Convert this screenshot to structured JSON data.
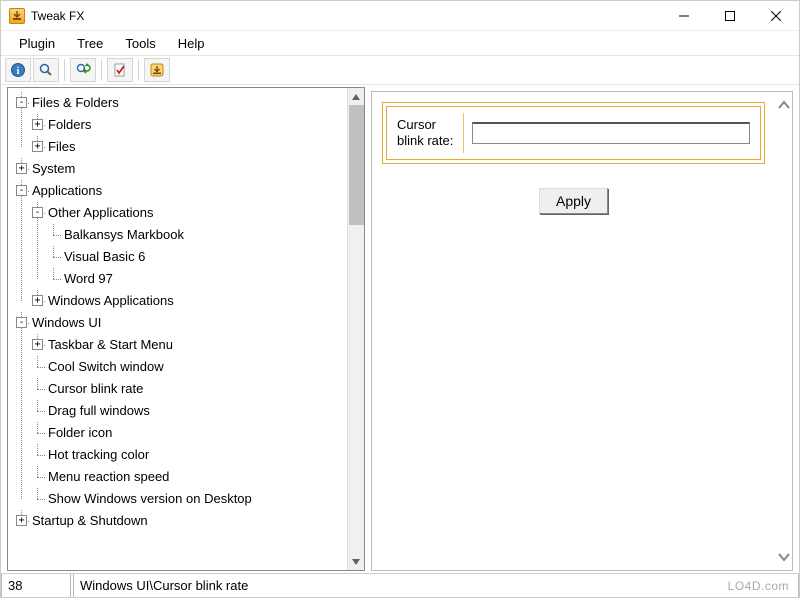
{
  "window": {
    "title": "Tweak FX"
  },
  "menu": {
    "items": [
      "Plugin",
      "Tree",
      "Tools",
      "Help"
    ]
  },
  "toolbar": {
    "buttons": [
      "info",
      "search",
      "refresh-search",
      "validate",
      "import"
    ]
  },
  "tree": {
    "nodes": [
      {
        "label": "Files & Folders",
        "expander": "-",
        "level": 0,
        "children": [
          {
            "label": "Folders",
            "expander": "+",
            "level": 1
          },
          {
            "label": "Files",
            "expander": "+",
            "level": 1
          }
        ]
      },
      {
        "label": "System",
        "expander": "+",
        "level": 0
      },
      {
        "label": "Applications",
        "expander": "-",
        "level": 0,
        "children": [
          {
            "label": "Other Applications",
            "expander": "-",
            "level": 1,
            "children": [
              {
                "label": "Balkansys Markbook",
                "level": 2
              },
              {
                "label": "Visual Basic 6",
                "level": 2
              },
              {
                "label": "Word 97",
                "level": 2
              }
            ]
          },
          {
            "label": "Windows Applications",
            "expander": "+",
            "level": 1
          }
        ]
      },
      {
        "label": "Windows UI",
        "expander": "-",
        "level": 0,
        "children": [
          {
            "label": "Taskbar & Start Menu",
            "expander": "+",
            "level": 1
          },
          {
            "label": "Cool Switch window",
            "level": 1
          },
          {
            "label": "Cursor blink rate",
            "level": 1
          },
          {
            "label": "Drag full windows",
            "level": 1
          },
          {
            "label": "Folder icon",
            "level": 1
          },
          {
            "label": "Hot tracking color",
            "level": 1
          },
          {
            "label": "Menu reaction speed",
            "level": 1
          },
          {
            "label": "Show Windows version on Desktop",
            "level": 1
          }
        ]
      },
      {
        "label": "Startup & Shutdown",
        "expander": "+",
        "level": 0
      }
    ]
  },
  "detail": {
    "field_label_line1": "Cursor",
    "field_label_line2": "blink rate:",
    "field_value": "",
    "apply_label": "Apply"
  },
  "status": {
    "count": "38",
    "path": "Windows UI\\Cursor blink rate"
  },
  "watermark": "LO4D.com"
}
